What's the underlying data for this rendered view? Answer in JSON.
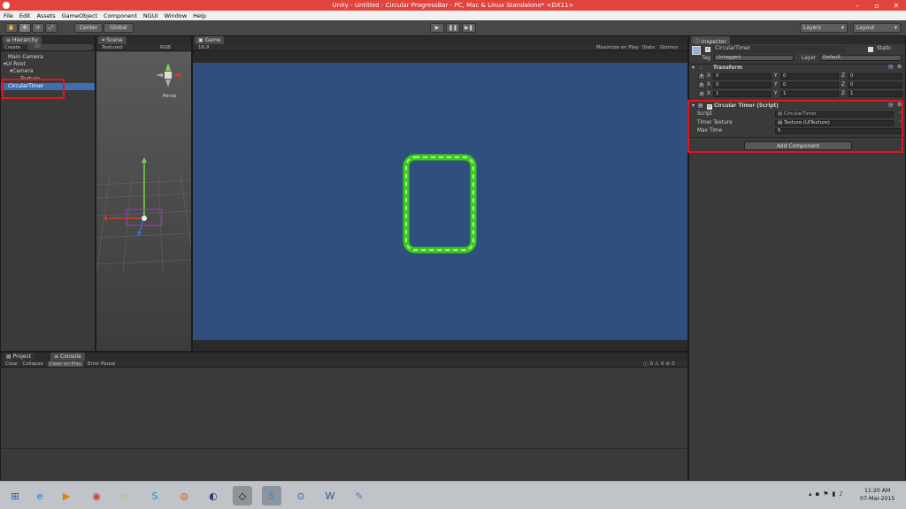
{
  "window": {
    "title": "Unity - Untitled - Circular ProgressBar - PC, Mac & Linux Standalone* <DX11>",
    "controls": [
      "–",
      "▫",
      "✕"
    ]
  },
  "menu": [
    "File",
    "Edit",
    "Assets",
    "GameObject",
    "Component",
    "NGUI",
    "Window",
    "Help"
  ],
  "toolbar": {
    "pivot": "Center",
    "space": "Global",
    "layers": "Layers",
    "layout": "Layout"
  },
  "hierarchy": {
    "tab": "Hierarchy",
    "create": "Create",
    "search_placeholder": "All",
    "items": [
      "Main Camera",
      "UI Root",
      "Camera",
      "Texture",
      "CircularTimer"
    ],
    "selected": "CircularTimer"
  },
  "scene": {
    "tab": "Scene",
    "shading": "Textured",
    "rgb": "RGB",
    "gizmo_label": "Persp"
  },
  "game": {
    "tab": "Game",
    "aspect": "16:9",
    "maximize": "Maximize on Play",
    "stats": "Stats",
    "gizmos": "Gizmos",
    "bg_color": "#2f4f7f",
    "frame_color": "#3ccc1e"
  },
  "inspector": {
    "tab": "Inspector",
    "object_name": "CircularTimer",
    "static_label": "Static",
    "tag_label": "Tag",
    "tag_value": "Untagged",
    "layer_label": "Layer",
    "layer_value": "Default",
    "transform": {
      "title": "Transform",
      "rows": [
        {
          "btn": "P",
          "x": "0",
          "y": "0",
          "z": "0"
        },
        {
          "btn": "R",
          "x": "0",
          "y": "0",
          "z": "0"
        },
        {
          "btn": "S",
          "x": "1",
          "y": "1",
          "z": "1"
        }
      ],
      "axis_x": "X",
      "axis_y": "Y",
      "axis_z": "Z"
    },
    "script_component": {
      "title": "Circular Timer (Script)",
      "fields": [
        {
          "label": "Script",
          "value": "CircularTimer"
        },
        {
          "label": "Timer Texture",
          "value": "Texture (UITexture)"
        },
        {
          "label": "Max Time",
          "value": "5"
        }
      ]
    },
    "add_component": "Add Component"
  },
  "console": {
    "tabs": [
      "Project",
      "Console"
    ],
    "buttons": [
      "Clear",
      "Collapse",
      "Clear on Play",
      "Error Pause"
    ],
    "counts": [
      "0",
      "0",
      "0"
    ]
  },
  "taskbar": {
    "time": "11:20 AM",
    "date": "07-Mar-2015",
    "apps": [
      "start-icon",
      "ie-icon",
      "media-icon",
      "chrome-icon",
      "explorer-icon",
      "skype-icon",
      "firefox-icon",
      "eclipse-icon",
      "unity-icon",
      "skype-blue-icon",
      "remote-icon",
      "word-icon",
      "paint-icon"
    ]
  },
  "colors": {
    "highlight": "#e0151f",
    "selection": "#3d6fb2"
  }
}
